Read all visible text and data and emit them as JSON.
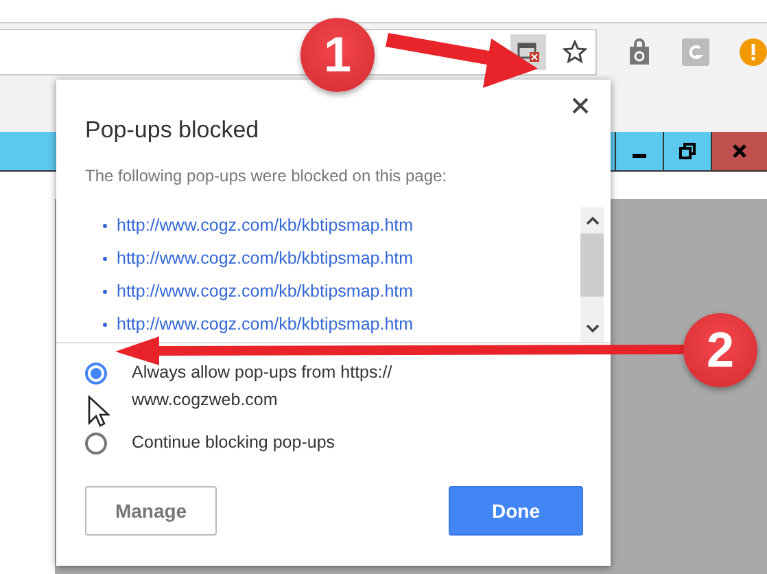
{
  "callouts": [
    {
      "label": "1"
    },
    {
      "label": "2"
    }
  ],
  "popup": {
    "title": "Pop-ups blocked",
    "message": "The following pop-ups were blocked on this page:",
    "blocked_urls": [
      "http://www.cogz.com/kb/kbtipsmap.htm",
      "http://www.cogz.com/kb/kbtipsmap.htm",
      "http://www.cogz.com/kb/kbtipsmap.htm",
      "http://www.cogz.com/kb/kbtipsmap.htm"
    ],
    "options": [
      {
        "label": "Always allow pop-ups from https://\nwww.cogzweb.com",
        "selected": true
      },
      {
        "label": "Continue blocking pop-ups",
        "selected": false
      }
    ],
    "buttons": [
      {
        "label": "Manage",
        "kind": "secondary"
      },
      {
        "label": "Done",
        "kind": "primary"
      }
    ]
  }
}
